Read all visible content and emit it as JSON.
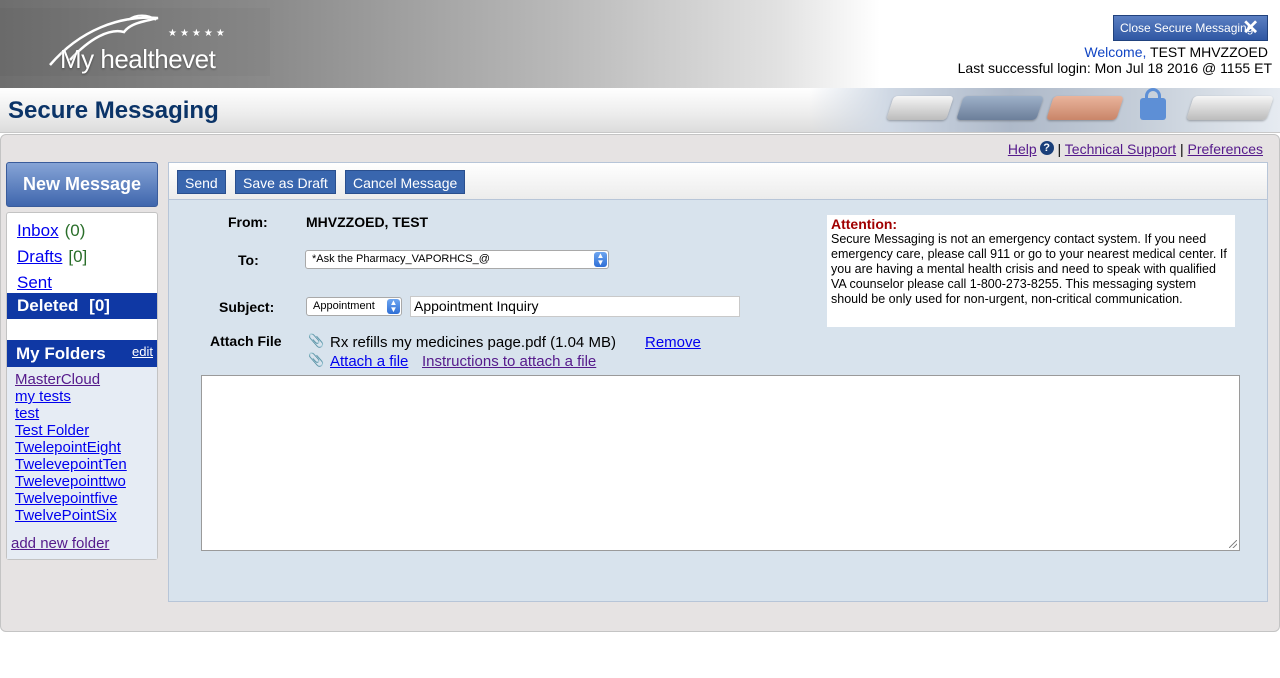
{
  "header": {
    "logo_text": "My healthevet",
    "close_button_label": "Close Secure Messaging",
    "welcome_label": "Welcome,",
    "user_name": "TEST MHVZZOED",
    "last_login": "Last successful login: Mon Jul 18 2016 @ 1155 ET"
  },
  "page": {
    "title": "Secure Messaging"
  },
  "top_links": {
    "help": "Help",
    "technical_support": "Technical Support",
    "preferences": "Preferences",
    "separator": "|"
  },
  "sidebar": {
    "new_message": "New Message",
    "items": [
      {
        "label": "Inbox",
        "count": "(0)"
      },
      {
        "label": "Drafts",
        "count": "[0]"
      },
      {
        "label": "Sent",
        "count": ""
      },
      {
        "label": "Deleted",
        "count": "[0]"
      }
    ],
    "folders_title": "My Folders",
    "folders_edit": "edit",
    "folders": [
      "MasterCloud",
      "my tests",
      "test",
      "Test Folder",
      "TwelepointEight",
      "TwelevepointTen",
      "Twelevepointtwo",
      "Twelvepointfive",
      "TwelvePointSix"
    ],
    "add_folder": "add new folder"
  },
  "toolbar": {
    "send": "Send",
    "save_draft": "Save as Draft",
    "cancel": "Cancel Message"
  },
  "form": {
    "from_label": "From:",
    "from_value": "MHVZZOED, TEST",
    "to_label": "To:",
    "to_value": "*Ask the Pharmacy_VAPORHCS_@",
    "subject_label": "Subject:",
    "subject_category": "Appointment",
    "subject_value": "Appointment Inquiry",
    "attach_label": "Attach File",
    "attached_file": "Rx refills my medicines page.pdf (1.04 MB)",
    "remove": "Remove",
    "attach_a_file": "Attach a file",
    "instructions": "Instructions to attach a file",
    "body": ""
  },
  "attention": {
    "title": "Attention:",
    "text": "Secure Messaging is not an emergency contact system. If you need emergency care, please call 911 or go to your nearest medical center. If you are having a mental health crisis and need to speak with qualified VA counselor please call 1-800-273-8255. This messaging system should be only used for non-urgent, non-critical communication."
  },
  "colors": {
    "brand_blue": "#0f38a4",
    "title_blue": "#0b3468",
    "attention_red": "#a00000",
    "compose_bg": "#d8e3ed"
  }
}
